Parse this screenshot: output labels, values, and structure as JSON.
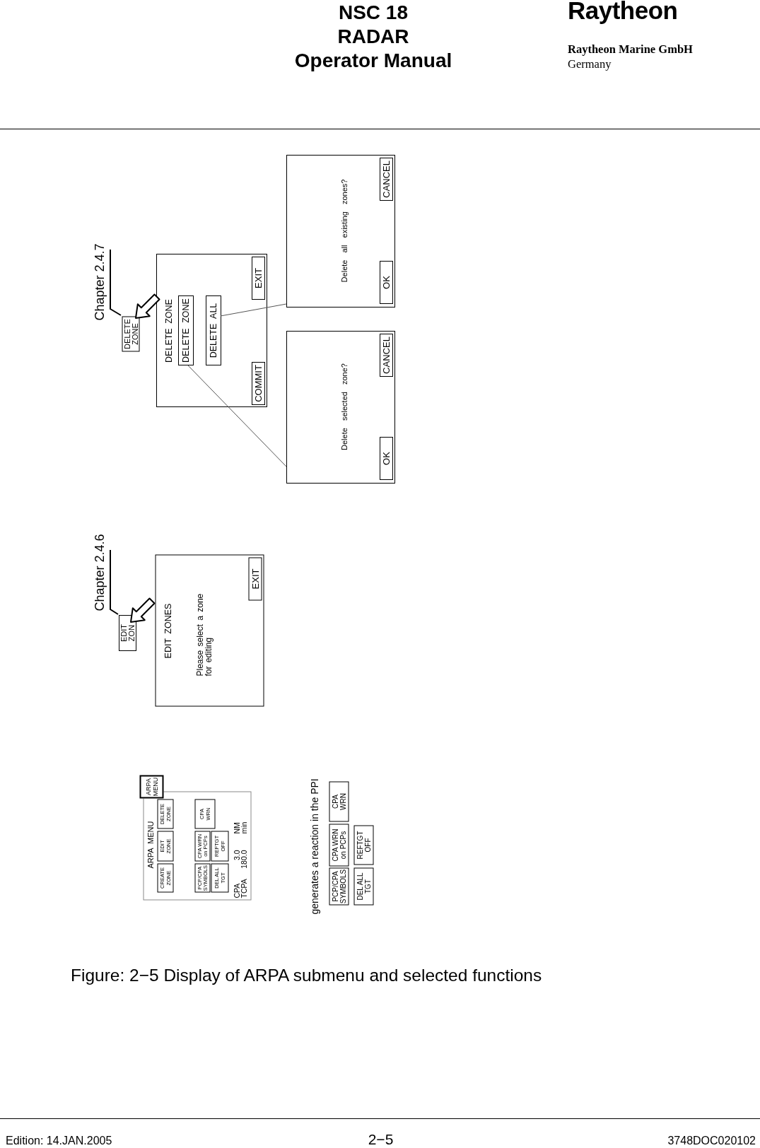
{
  "header": {
    "title_lines": [
      "NSC 18",
      "RADAR",
      "Operator Manual"
    ],
    "logo": "Raytheon",
    "company": "Raytheon Marine GmbH",
    "country": "Germany"
  },
  "delete_zone_view": {
    "chapter": "Chapter 2.4.7",
    "softkey_lines": [
      "DELETE",
      "ZONE"
    ],
    "menu": {
      "title": "DELETE ZONE",
      "options": [
        "DELETE ZONE",
        "DELETE ALL"
      ],
      "buttons": [
        "COMMIT",
        "EXIT"
      ]
    },
    "confirm_selected": {
      "message": "Delete selected zone?",
      "buttons": [
        "OK",
        "CANCEL"
      ]
    },
    "confirm_all": {
      "message": "Delete all existing zones?",
      "buttons": [
        "OK",
        "CANCEL"
      ]
    }
  },
  "edit_zone_view": {
    "chapter": "Chapter 2.4.6",
    "softkey_lines": [
      "EDIT",
      "ZON"
    ],
    "menu": {
      "title": "EDIT ZONES",
      "message_lines": [
        "Please select a zone",
        "for editing"
      ],
      "buttons": [
        "EXIT"
      ]
    }
  },
  "arpa_menu_view": {
    "softkey_lines": [
      "ARPA",
      "MENU"
    ],
    "menu": {
      "title": "ARPA MENU",
      "button_rows": [
        [
          {
            "lines": [
              "CREATE",
              "ZONE"
            ]
          },
          {
            "lines": [
              "EDIT",
              "ZONE"
            ]
          },
          {
            "lines": [
              "DELETE",
              "ZONE"
            ]
          }
        ],
        [
          {
            "lines": [
              "PCP/CPA",
              "SYMBOLS"
            ]
          },
          {
            "lines": [
              "CPA WRN",
              "on PCPs"
            ]
          },
          {
            "lines": [
              "CPA",
              "WRN"
            ]
          }
        ],
        [
          {
            "lines": [
              "DEL ALL",
              "TGT"
            ]
          },
          {
            "lines": [
              "REFTGT",
              "OFF"
            ]
          }
        ]
      ],
      "readouts": [
        {
          "label": "CPA",
          "value": "3.0",
          "unit": "NM"
        },
        {
          "label": "TCPA",
          "value": "180.0",
          "unit": "min"
        }
      ]
    }
  },
  "ppi_reaction": {
    "text": "generates a reaction in the PPI",
    "button_rows": [
      [
        {
          "lines": [
            "PCP/CPA",
            "SYMBOLS"
          ]
        },
        {
          "lines": [
            "CPA WRN",
            "on PCPs"
          ]
        },
        {
          "lines": [
            "CPA",
            "WRN"
          ]
        }
      ],
      [
        {
          "lines": [
            "DEL ALL",
            "TGT"
          ]
        },
        {
          "lines": [
            "REFTGT",
            "OFF"
          ]
        }
      ]
    ]
  },
  "caption": "Figure: 2−5 Display of ARPA submenu and selected functions",
  "footer": {
    "edition": "Edition: 14.JAN.2005",
    "page": "2−5",
    "document_number": "3748DOC020102"
  }
}
